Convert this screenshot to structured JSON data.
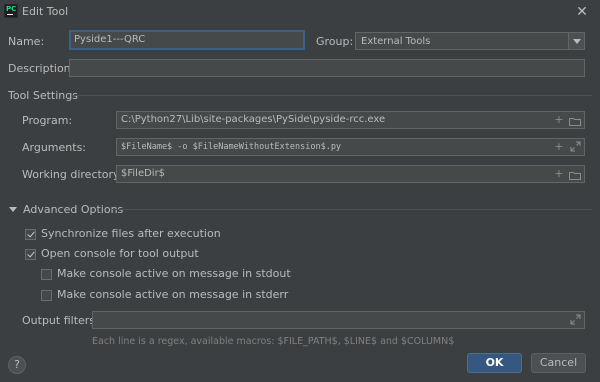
{
  "window": {
    "app_icon": "pycharm-icon",
    "title": "Edit Tool",
    "close_icon": "close-icon"
  },
  "name": {
    "label": "Name:",
    "value": "Pyside1---QRC"
  },
  "group": {
    "label": "Group:",
    "value": "External Tools",
    "arrow_icon": "chevron-down-icon"
  },
  "description": {
    "label": "Description:",
    "value": ""
  },
  "tool_settings": {
    "title": "Tool Settings",
    "program": {
      "label": "Program:",
      "value": "C:\\Python27\\Lib\\site-packages\\PySide\\pyside-rcc.exe",
      "icons": [
        "plus-icon",
        "folder-icon"
      ]
    },
    "arguments": {
      "label": "Arguments:",
      "value": "$FileName$ -o $FileNameWithoutExtension$.py",
      "icons": [
        "plus-icon",
        "expand-icon"
      ]
    },
    "working_directory": {
      "label": "Working directory:",
      "value": "$FileDir$",
      "icons": [
        "plus-icon",
        "folder-icon"
      ]
    }
  },
  "advanced": {
    "title": "Advanced Options",
    "toggle_icon": "triangle-down-icon",
    "options": [
      {
        "label": "Synchronize files after execution",
        "checked": true
      },
      {
        "label": "Open console for tool output",
        "checked": true
      },
      {
        "label": "Make console active on message in stdout",
        "checked": false
      },
      {
        "label": "Make console active on message in stderr",
        "checked": false
      }
    ],
    "output_filters": {
      "label": "Output filters:",
      "value": "",
      "icon": "expand-icon"
    },
    "hint": "Each line is a regex, available macros: $FILE_PATH$, $LINE$ and $COLUMN$"
  },
  "buttons": {
    "help": "?",
    "ok": "OK",
    "cancel": "Cancel"
  },
  "colors": {
    "background": "#3c3f41",
    "field": "#45494a",
    "ok_button": "#365880",
    "focus_border": "#3d6185"
  }
}
